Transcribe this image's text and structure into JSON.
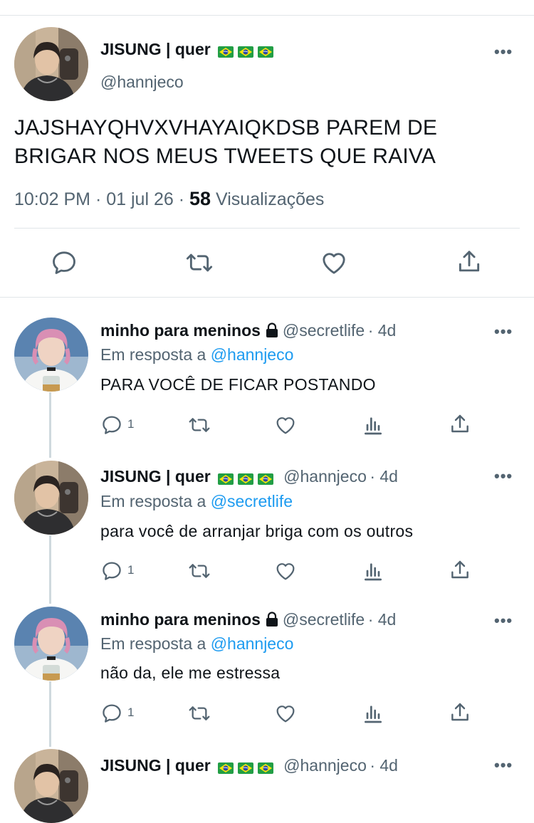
{
  "main_tweet": {
    "name": "JISUNG | quer",
    "flags": [
      "🇧🇷",
      "🇧🇷",
      "🇧🇷"
    ],
    "handle": "@hannjeco",
    "more": "•••",
    "text_line1": "JAJSHAYQHVXVHAYAIQKDSB PAREM DE",
    "text_line2": "BRIGAR NOS MEUS TWEETS QUE RAIVA",
    "time": "10:02 PM",
    "dot": "·",
    "date": "01 jul 26",
    "views_count": "58",
    "views_label": "Visualizações",
    "icons": [
      "reply-icon",
      "retweet-icon",
      "like-icon",
      "share-icon"
    ]
  },
  "replies": [
    {
      "name": "minho para meninos",
      "locked": true,
      "handle": "@secretlife",
      "time": "· 4d",
      "reply_prefix": "Em resposta a",
      "reply_to": "@hannjeco",
      "text": "PARA VOCÊ DE FICAR POSTANDO",
      "reply_count": "1"
    },
    {
      "name": "JISUNG | quer",
      "flags": [
        "🇧🇷",
        "🇧🇷",
        "🇧🇷"
      ],
      "handle": "@hannjeco",
      "time": "· 4d",
      "reply_prefix": "Em resposta a",
      "reply_to": "@secretlife",
      "text": "para você de arranjar briga com os outros",
      "reply_count": "1"
    },
    {
      "name": "minho para meninos",
      "locked": true,
      "handle": "@secretlife",
      "time": "· 4d",
      "reply_prefix": "Em resposta a",
      "reply_to": "@hannjeco",
      "text": "não da, ele me estressa",
      "reply_count": "1"
    },
    {
      "name": "JISUNG | quer",
      "flags": [
        "🇧🇷",
        "🇧🇷",
        "🇧🇷"
      ],
      "handle": "@hannjeco",
      "time": "· 4d"
    }
  ],
  "colors": {
    "text": "#0f1419",
    "secondary": "#536471",
    "link": "#1d9bf0",
    "divider": "#e1e5e8"
  }
}
